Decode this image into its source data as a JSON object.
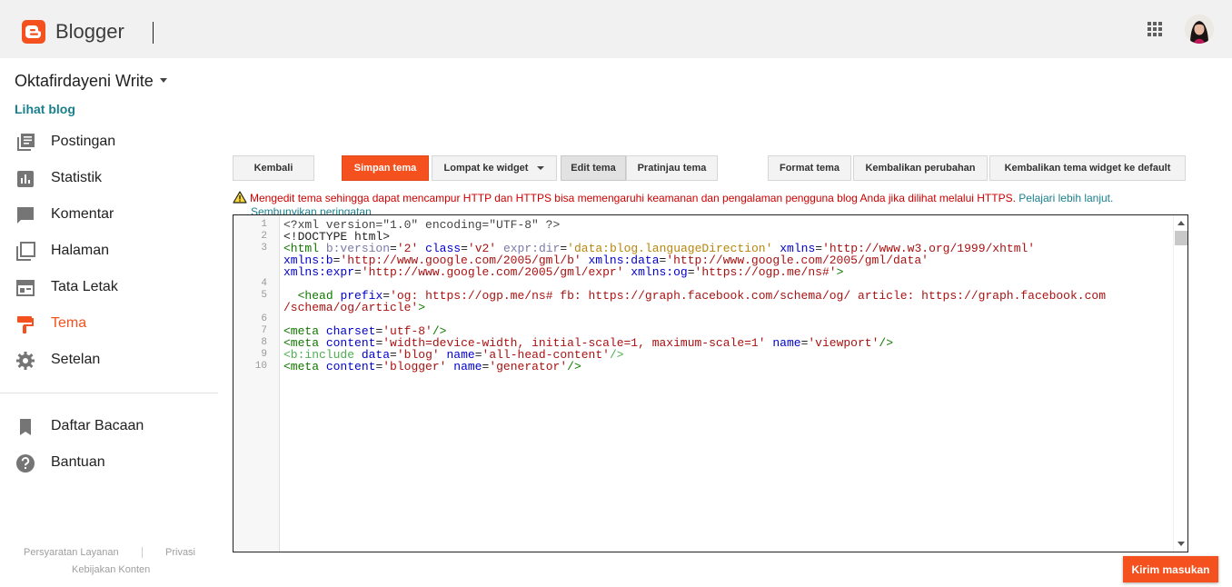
{
  "app": {
    "name": "Blogger",
    "accent": "#f4511e",
    "link_color": "#1a7f8c"
  },
  "header": {
    "apps_icon": "apps-grid-icon",
    "avatar": "user-avatar"
  },
  "sidebar": {
    "blog_name": "Oktafirdayeni Write",
    "view_blog": "Lihat blog",
    "items": [
      {
        "label": "Postingan",
        "icon": "posts-icon"
      },
      {
        "label": "Statistik",
        "icon": "stats-icon"
      },
      {
        "label": "Komentar",
        "icon": "comment-icon"
      },
      {
        "label": "Halaman",
        "icon": "pages-icon"
      },
      {
        "label": "Tata Letak",
        "icon": "layout-icon"
      },
      {
        "label": "Tema",
        "icon": "theme-icon",
        "active": true
      },
      {
        "label": "Setelan",
        "icon": "settings-icon"
      }
    ],
    "secondary": [
      {
        "label": "Daftar Bacaan",
        "icon": "bookmark-icon"
      },
      {
        "label": "Bantuan",
        "icon": "help-icon"
      }
    ],
    "footer": {
      "terms": "Persyaratan Layanan",
      "privacy": "Privasi",
      "content_policy": "Kebijakan Konten"
    }
  },
  "toolbar": {
    "back": "Kembali",
    "save": "Simpan tema",
    "jump": "Lompat ke widget",
    "edit": "Edit tema",
    "preview": "Pratinjau tema",
    "format": "Format tema",
    "revert": "Kembalikan perubahan",
    "reset_widgets": "Kembalikan tema widget ke default"
  },
  "warning": {
    "text": "Mengedit tema sehingga dapat mencampur HTTP dan HTTPS bisa memengaruhi keamanan dan pengalaman pengguna blog Anda jika dilihat melalui HTTPS.",
    "learn_more": "Pelajari lebih lanjut.",
    "dismiss": "Sembunyikan peringatan"
  },
  "editor": {
    "line_numbers": [
      "1",
      "2",
      "3",
      "4",
      "5",
      "6",
      "7",
      "8",
      "9",
      "10"
    ]
  },
  "feedback": "Kirim masukan"
}
